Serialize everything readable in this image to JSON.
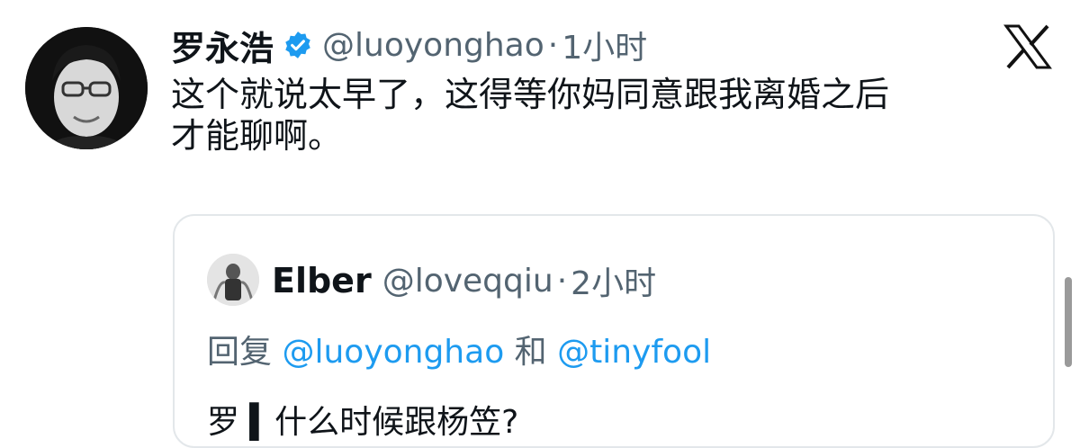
{
  "tweet": {
    "display_name": "罗永浩",
    "handle": "@luoyonghao",
    "separator": "·",
    "time": "1小时",
    "text_line1": "这个就说太早了，这得等你妈同意跟我离婚之后",
    "text_line2": "才能聊啊。"
  },
  "quote": {
    "display_name": "Elber",
    "handle": "@loveqqiu",
    "separator": "·",
    "time": "2小时",
    "reply_prefix": "回复",
    "reply_mention1": "@luoyonghao",
    "reply_conjunction": "和",
    "reply_mention2": "@tinyfool",
    "text_partial": "罗 ▍什么时候跟杨笠?"
  },
  "colors": {
    "link": "#1d9bf0",
    "secondary_text": "#536471",
    "primary_text": "#0f1419",
    "border": "#e3e7ea"
  },
  "icons": {
    "verified": "verified-badge-icon",
    "close": "x-logo-icon"
  }
}
